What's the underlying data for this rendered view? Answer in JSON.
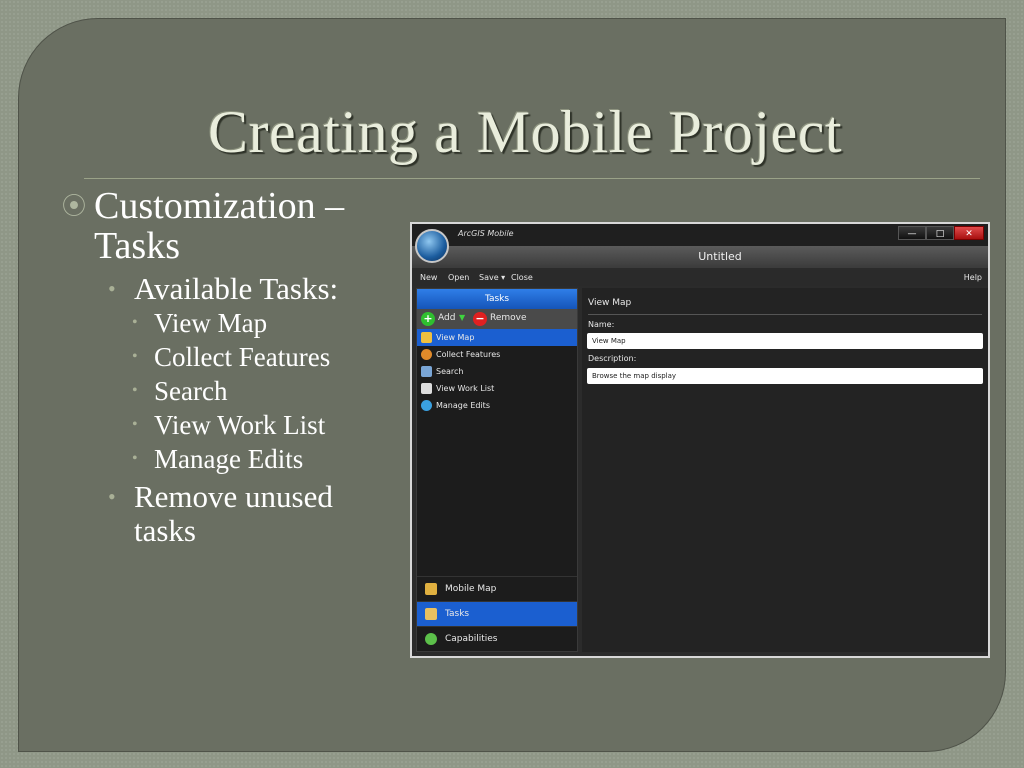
{
  "slide": {
    "title": "Creating a Mobile Project",
    "bullet1": {
      "line1": "Customization –",
      "line2": "Tasks"
    },
    "sub1": "Available Tasks:",
    "tasks": [
      "View Map",
      "Collect Features",
      "Search",
      "View Work List",
      "Manage Edits"
    ],
    "sub2": {
      "line1": "Remove unused",
      "line2": "tasks"
    },
    "bullet_glyph": "⦿",
    "dot": "•"
  },
  "app": {
    "name": "ArcGIS Mobile",
    "document": "Untitled",
    "window_buttons": {
      "minimize": "—",
      "maximize": "□",
      "close": "✕"
    },
    "menu": [
      "New",
      "Open",
      "Save ▾",
      "Close"
    ],
    "help": "Help",
    "tasks_header": "Tasks",
    "add_label": "Add",
    "remove_label": "Remove",
    "task_list": [
      {
        "label": "View Map",
        "selected": true,
        "icon": "map-icon",
        "color": "#f0c040"
      },
      {
        "label": "Collect Features",
        "selected": false,
        "icon": "collect-icon",
        "color": "#e08a2a"
      },
      {
        "label": "Search",
        "selected": false,
        "icon": "search-icon",
        "color": "#7aa6d6"
      },
      {
        "label": "View Work List",
        "selected": false,
        "icon": "document-icon",
        "color": "#dddddd"
      },
      {
        "label": "Manage Edits",
        "selected": false,
        "icon": "sync-icon",
        "color": "#3aa0e0"
      }
    ],
    "nav": [
      {
        "label": "Mobile Map",
        "selected": false,
        "icon": "mobile-map-icon",
        "color": "#e0b040"
      },
      {
        "label": "Tasks",
        "selected": true,
        "icon": "clipboard-icon",
        "color": "#e8c060"
      },
      {
        "label": "Capabilities",
        "selected": false,
        "icon": "capabilities-icon",
        "color": "#5cc04a"
      }
    ],
    "details": {
      "title": "View Map",
      "name_label": "Name:",
      "name_value": "View Map",
      "description_label": "Description:",
      "description_value": "Browse the map display"
    }
  },
  "colors": {
    "slide_bg": "#6a6f62",
    "accent_blue": "#1b5fd0",
    "title_text": "#e9eddc"
  }
}
